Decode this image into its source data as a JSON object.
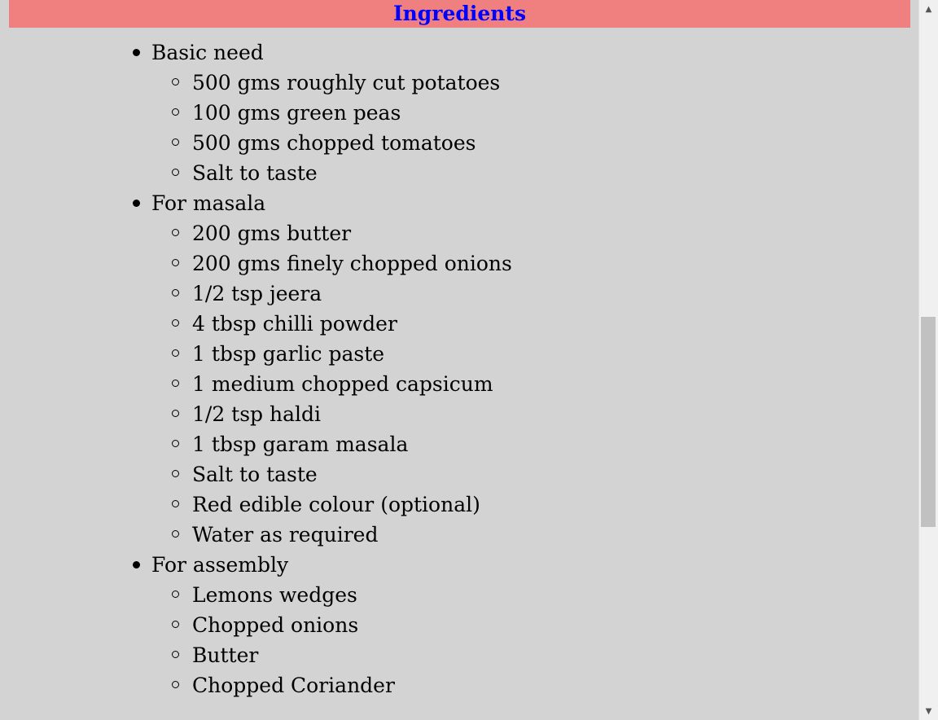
{
  "header": {
    "title": "Ingredients",
    "background_color": "#f08080",
    "title_color": "#0000ff"
  },
  "page": {
    "background_color": "#d3d3d3"
  },
  "groups": [
    {
      "label": "Basic need",
      "items": [
        "500 gms roughly cut potatoes",
        "100 gms green peas",
        "500 gms chopped tomatoes",
        "Salt to taste"
      ]
    },
    {
      "label": "For masala",
      "items": [
        "200 gms butter",
        "200 gms finely chopped onions",
        "1/2 tsp jeera",
        "4 tbsp chilli powder",
        "1 tbsp garlic paste",
        "1 medium chopped capsicum",
        "1/2 tsp haldi",
        "1 tbsp garam masala",
        "Salt to taste",
        "Red edible colour (optional)",
        "Water as required"
      ]
    },
    {
      "label": "For assembly",
      "items": [
        "Lemons wedges",
        "Chopped onions",
        "Butter",
        "Chopped Coriander"
      ]
    }
  ],
  "scrollbar": {
    "up_icon": "chevron-up-icon",
    "down_icon": "chevron-down-icon"
  }
}
